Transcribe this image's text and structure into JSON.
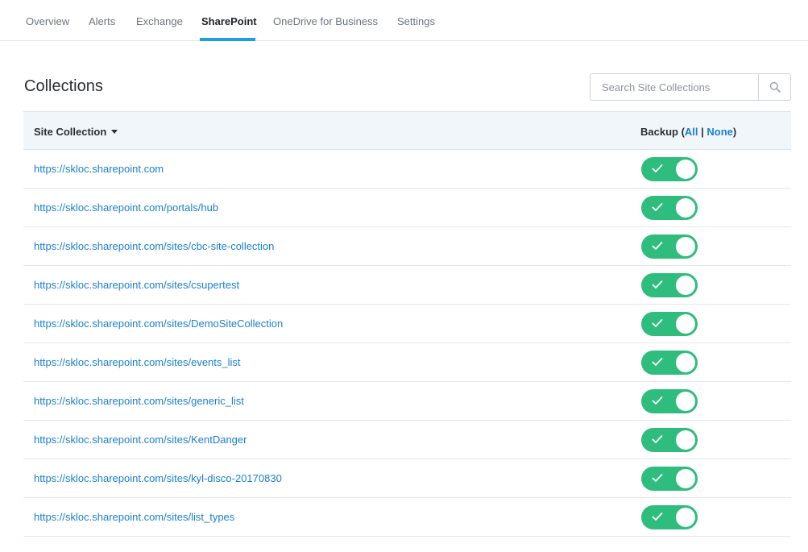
{
  "tabs": [
    {
      "label": "Overview"
    },
    {
      "label": "Alerts"
    },
    {
      "label": "Exchange"
    },
    {
      "label": "SharePoint"
    },
    {
      "label": "OneDrive for Business"
    },
    {
      "label": "Settings"
    }
  ],
  "active_tab": "SharePoint",
  "page": {
    "title": "Collections"
  },
  "search": {
    "placeholder": "Search Site Collections",
    "value": ""
  },
  "table": {
    "col_site": "Site Collection",
    "col_backup_prefix": "Backup (",
    "col_backup_all": "All",
    "col_backup_sep": " | ",
    "col_backup_none": "None",
    "col_backup_suffix": ")",
    "rows": [
      {
        "url": "https://skloc.sharepoint.com",
        "backup": true
      },
      {
        "url": "https://skloc.sharepoint.com/portals/hub",
        "backup": true
      },
      {
        "url": "https://skloc.sharepoint.com/sites/cbc-site-collection",
        "backup": true
      },
      {
        "url": "https://skloc.sharepoint.com/sites/csupertest",
        "backup": true
      },
      {
        "url": "https://skloc.sharepoint.com/sites/DemoSiteCollection",
        "backup": true
      },
      {
        "url": "https://skloc.sharepoint.com/sites/events_list",
        "backup": true
      },
      {
        "url": "https://skloc.sharepoint.com/sites/generic_list",
        "backup": true
      },
      {
        "url": "https://skloc.sharepoint.com/sites/KentDanger",
        "backup": true
      },
      {
        "url": "https://skloc.sharepoint.com/sites/kyl-disco-20170830",
        "backup": true
      },
      {
        "url": "https://skloc.sharepoint.com/sites/list_types",
        "backup": true
      }
    ]
  },
  "colors": {
    "accent": "#1ba1e2",
    "link": "#1a7fd0",
    "toggle_on": "#2ebd7d",
    "header_bg": "#f1f6fb"
  },
  "icons": {
    "search": "search-icon",
    "sort": "caret-down-icon",
    "toggle_check": "check-icon"
  }
}
